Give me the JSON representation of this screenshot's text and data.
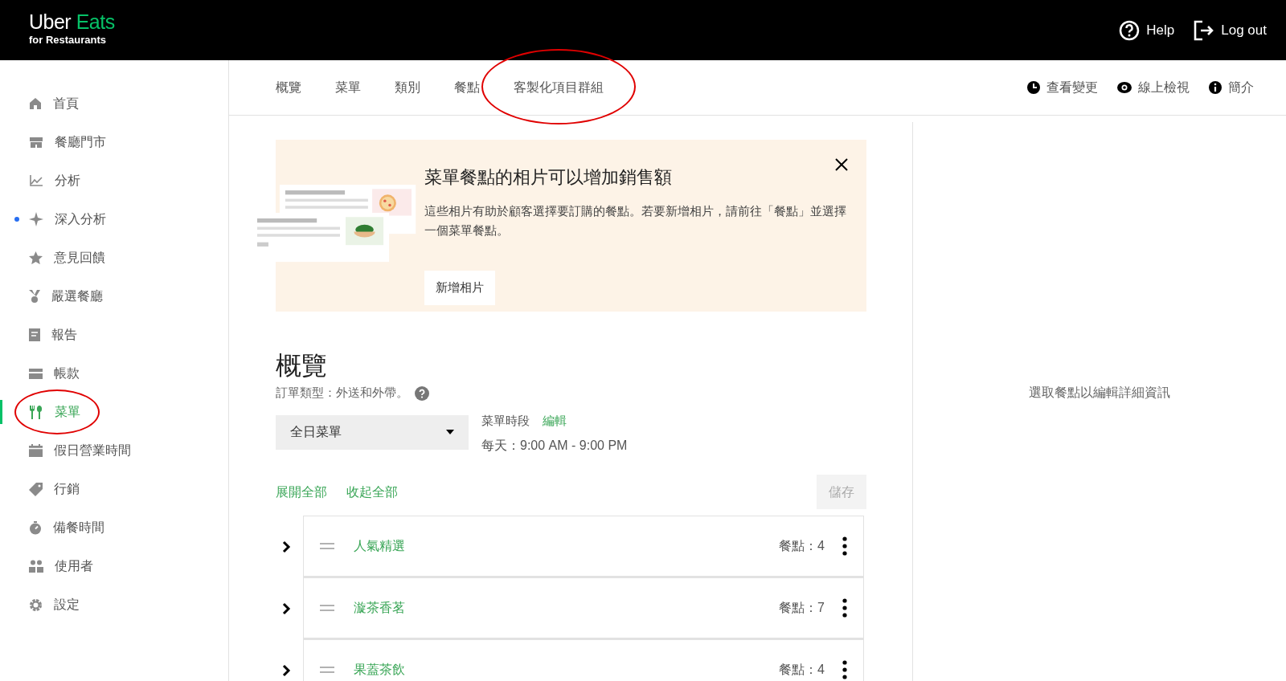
{
  "header": {
    "logo_main": "Uber",
    "logo_accent": "Eats",
    "logo_sub": "for Restaurants",
    "actions": [
      {
        "label": "Help"
      },
      {
        "label": "Log out"
      }
    ]
  },
  "sidebar": {
    "items": [
      {
        "label": "首頁",
        "selected": false,
        "new_dot": false,
        "circled": false
      },
      {
        "label": "餐廳門市",
        "selected": false,
        "new_dot": false,
        "circled": false
      },
      {
        "label": "分析",
        "selected": false,
        "new_dot": false,
        "circled": false
      },
      {
        "label": "深入分析",
        "selected": false,
        "new_dot": true,
        "circled": false
      },
      {
        "label": "意見回饋",
        "selected": false,
        "new_dot": false,
        "circled": false
      },
      {
        "label": "嚴選餐廳",
        "selected": false,
        "new_dot": false,
        "circled": false
      },
      {
        "label": "報告",
        "selected": false,
        "new_dot": false,
        "circled": false
      },
      {
        "label": "帳款",
        "selected": false,
        "new_dot": false,
        "circled": false
      },
      {
        "label": "菜單",
        "selected": true,
        "new_dot": false,
        "circled": true
      },
      {
        "label": "假日營業時間",
        "selected": false,
        "new_dot": false,
        "circled": false
      },
      {
        "label": "行銷",
        "selected": false,
        "new_dot": false,
        "circled": false
      },
      {
        "label": "備餐時間",
        "selected": false,
        "new_dot": false,
        "circled": false
      },
      {
        "label": "使用者",
        "selected": false,
        "new_dot": false,
        "circled": false
      },
      {
        "label": "設定",
        "selected": false,
        "new_dot": false,
        "circled": false
      }
    ]
  },
  "tabs": [
    {
      "label": "概覽",
      "circled": false
    },
    {
      "label": "菜單",
      "circled": false
    },
    {
      "label": "類別",
      "circled": false
    },
    {
      "label": "餐點",
      "circled": false
    },
    {
      "label": "客製化項目群組",
      "circled": true
    }
  ],
  "toolbar_actions": [
    {
      "label": "查看變更"
    },
    {
      "label": "線上檢視"
    },
    {
      "label": "簡介"
    }
  ],
  "banner": {
    "title": "菜單餐點的相片可以增加銷售額",
    "text": "這些相片有助於顧客選擇要訂購的餐點。若要新增相片，請前往「餐點」並選擇一個菜單餐點。",
    "button": "新增相片"
  },
  "overview": {
    "title": "概覽",
    "order_type": "訂單類型：外送和外帶。",
    "menu_select": "全日菜單",
    "hours_label": "菜單時段",
    "edit_link": "編輯",
    "hours": "每天：9:00 AM - 9:00 PM"
  },
  "controls": {
    "expand_all": "展開全部",
    "collapse_all": "收起全部",
    "save": "儲存",
    "save_disabled": true
  },
  "categories": [
    {
      "name": "人氣精選",
      "count": "餐點：4"
    },
    {
      "name": "漩茶香茗",
      "count": "餐點：7"
    },
    {
      "name": "果蓋茶飲",
      "count": "餐點：4"
    }
  ],
  "detail_panel": {
    "placeholder_text": "選取餐點以編輯詳細資訊"
  }
}
